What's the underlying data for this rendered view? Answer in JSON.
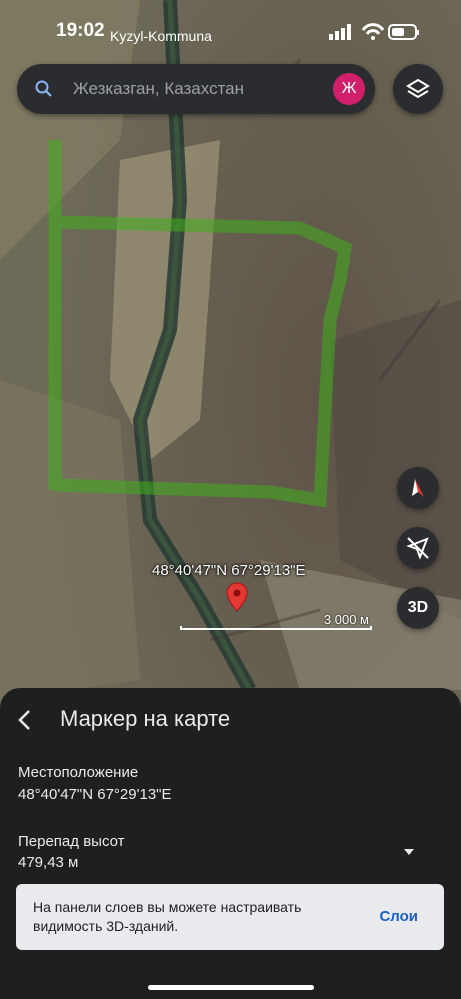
{
  "status_bar": {
    "time": "19:02",
    "location": "Kyzyl-Kommuna"
  },
  "search": {
    "query": "Жезказган, Казахстан",
    "avatar_letter": "Ж",
    "avatar_color": "#d21f6b"
  },
  "map": {
    "marker_coordinates": "48°40'47\"N 67°29'13\"E",
    "scale_label": "3 000 м",
    "highlight_color": "#3fae1c",
    "controls": {
      "three_d_label": "3D",
      "layers_icon": "layers-icon",
      "compass_icon": "compass-icon",
      "location_icon": "location-off-icon"
    }
  },
  "sheet": {
    "title": "Маркер на карте",
    "location_label": "Местоположение",
    "location_value": "48°40'47\"N 67°29'13\"E",
    "elevation_label": "Перепад высот",
    "elevation_value": "479,43 м"
  },
  "snackbar": {
    "message": "На панели слоев вы можете настраивать видимость 3D-зданий.",
    "action": "Слои"
  }
}
